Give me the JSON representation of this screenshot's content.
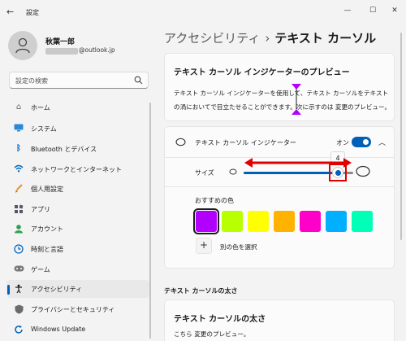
{
  "app": {
    "title": "設定"
  },
  "window_controls": {
    "minimize": "—",
    "maximize": "☐",
    "close": "✕"
  },
  "profile": {
    "name": "秋葉一郎",
    "email_visible": "@outlook.jp"
  },
  "search": {
    "placeholder": "設定の検索"
  },
  "sidebar": {
    "items": [
      {
        "label": "ホーム",
        "icon": "home-icon",
        "active": false
      },
      {
        "label": "システム",
        "icon": "system-icon",
        "active": false
      },
      {
        "label": "Bluetooth とデバイス",
        "icon": "bluetooth-icon",
        "active": false
      },
      {
        "label": "ネットワークとインターネット",
        "icon": "network-icon",
        "active": false
      },
      {
        "label": "個人用設定",
        "icon": "brush-icon",
        "active": false
      },
      {
        "label": "アプリ",
        "icon": "apps-icon",
        "active": false
      },
      {
        "label": "アカウント",
        "icon": "account-icon",
        "active": false
      },
      {
        "label": "時刻と言語",
        "icon": "globe-clock-icon",
        "active": false
      },
      {
        "label": "ゲーム",
        "icon": "gamepad-icon",
        "active": false
      },
      {
        "label": "アクセシビリティ",
        "icon": "accessibility-icon",
        "active": true
      },
      {
        "label": "プライバシーとセキュリティ",
        "icon": "shield-icon",
        "active": false
      },
      {
        "label": "Windows Update",
        "icon": "update-icon",
        "active": false
      }
    ]
  },
  "breadcrumb": {
    "parent": "アクセシビリティ",
    "separator": "›",
    "current": "テキスト カーソル"
  },
  "preview_card": {
    "title": "テキスト カーソル インジケーターのプレビュー",
    "body": "テキスト カーソル インジケーターを使用して、テキスト カーソルをテキストの渦においてで目立たせることができます。次に示すのは 変更のプレビュー。"
  },
  "indicator": {
    "label": "テキスト カーソル インジケーター",
    "toggle_label": "オン",
    "toggle_on": true,
    "size_label": "サイズ",
    "size_value": "4",
    "size_fraction": 0.86,
    "recommended_label": "おすすめの色",
    "colors": [
      "#b200ff",
      "#b8ff00",
      "#ffff00",
      "#ffb300",
      "#ff00c8",
      "#00b0ff",
      "#00ffb7"
    ],
    "selected_color_index": 0,
    "add_color_label": "別の色を選択"
  },
  "thickness": {
    "heading": "テキスト カーソルの太さ",
    "title": "テキスト カーソルの太さ",
    "body": "こちら 変更のプレビュー。"
  }
}
